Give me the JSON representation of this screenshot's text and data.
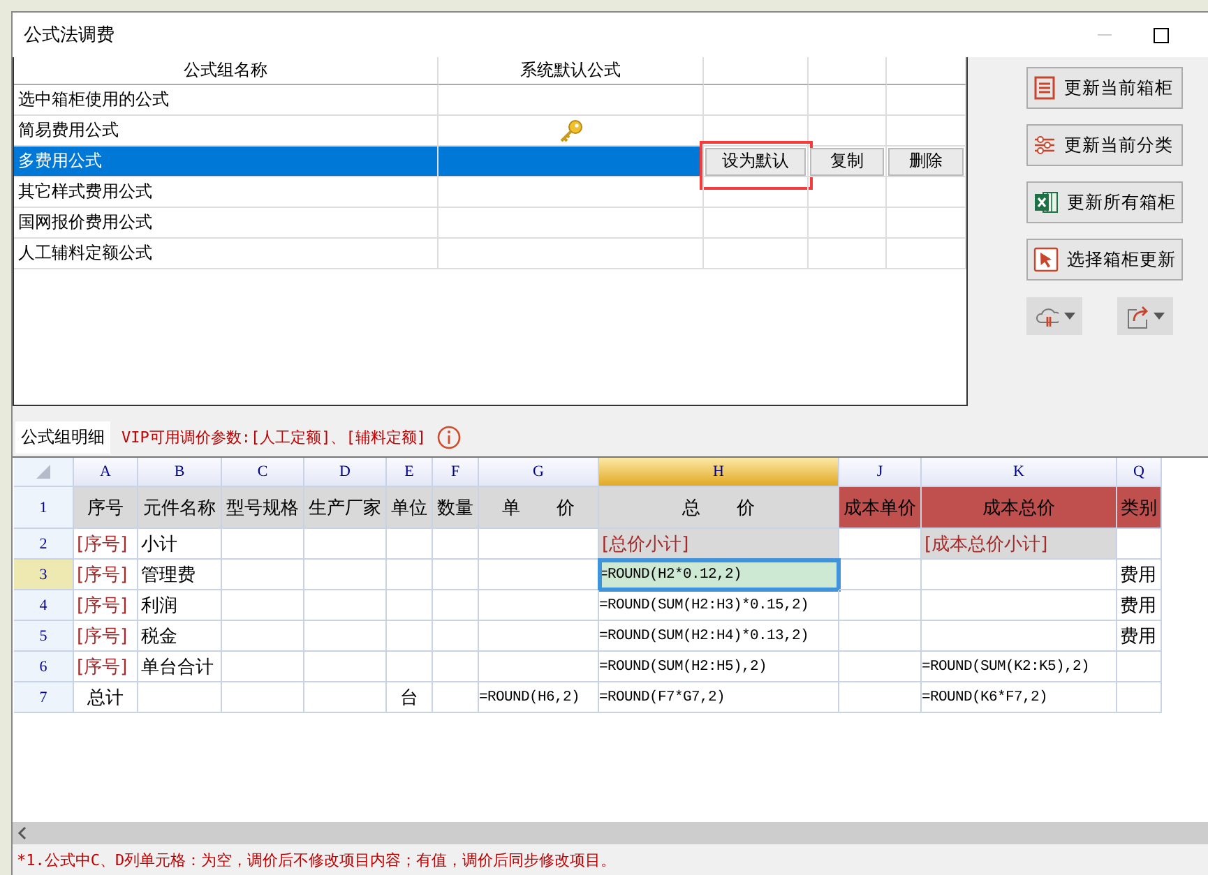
{
  "window": {
    "title": "公式法调费"
  },
  "formula_groups": {
    "columns": [
      "公式组名称",
      "系统默认公式"
    ],
    "rows": [
      {
        "name": "选中箱柜使用的公式",
        "is_default": false,
        "selected": false
      },
      {
        "name": "简易费用公式",
        "is_default": true,
        "selected": false
      },
      {
        "name": "多费用公式",
        "is_default": false,
        "selected": true
      },
      {
        "name": "其它样式费用公式",
        "is_default": false,
        "selected": false
      },
      {
        "name": "国网报价费用公式",
        "is_default": false,
        "selected": false
      },
      {
        "name": "人工辅料定额公式",
        "is_default": false,
        "selected": false
      }
    ],
    "row_actions": [
      {
        "label": "设为默认",
        "highlighted": true
      },
      {
        "label": "复制",
        "highlighted": false
      },
      {
        "label": "删除",
        "highlighted": false
      }
    ]
  },
  "side_buttons": [
    {
      "label": "更新当前箱柜"
    },
    {
      "label": "更新当前分类"
    },
    {
      "label": "更新所有箱柜"
    },
    {
      "label": "选择箱柜更新"
    }
  ],
  "detail": {
    "tab": "公式组明细",
    "vip_note": "VIP可用调价参数:[人工定额]、[辅料定额]",
    "columns": [
      {
        "letter": "A",
        "selected": false
      },
      {
        "letter": "B",
        "selected": false
      },
      {
        "letter": "C",
        "selected": false
      },
      {
        "letter": "D",
        "selected": false
      },
      {
        "letter": "E",
        "selected": false
      },
      {
        "letter": "F",
        "selected": false
      },
      {
        "letter": "G",
        "selected": false
      },
      {
        "letter": "H",
        "selected": true
      },
      {
        "letter": "J",
        "selected": false
      },
      {
        "letter": "K",
        "selected": false
      },
      {
        "letter": "Q",
        "selected": false
      }
    ],
    "rows": [
      {
        "number": "1",
        "selected": false,
        "cells": [
          {
            "text": "序号",
            "kind": "label"
          },
          {
            "text": "元件名称",
            "kind": "label"
          },
          {
            "text": "型号规格",
            "kind": "label"
          },
          {
            "text": "生产厂家",
            "kind": "label"
          },
          {
            "text": "单位",
            "kind": "label"
          },
          {
            "text": "数量",
            "kind": "label"
          },
          {
            "text": "单　　价",
            "kind": "label"
          },
          {
            "text": "总　　价",
            "kind": "label"
          },
          {
            "text": "成本单价",
            "kind": "cost_label"
          },
          {
            "text": "成本总价",
            "kind": "cost_label"
          },
          {
            "text": "类别",
            "kind": "cost_label"
          }
        ]
      },
      {
        "number": "2",
        "selected": false,
        "cells": [
          {
            "text": "[序号]",
            "kind": "token"
          },
          {
            "text": "小计",
            "kind": "text"
          },
          null,
          null,
          null,
          null,
          null,
          {
            "text": "[总价小计]",
            "kind": "subtotal"
          },
          null,
          {
            "text": "[成本总价小计]",
            "kind": "subtotal"
          },
          null
        ]
      },
      {
        "number": "3",
        "selected": true,
        "cells": [
          {
            "text": "[序号]",
            "kind": "token"
          },
          {
            "text": "管理费",
            "kind": "text"
          },
          null,
          null,
          null,
          null,
          null,
          {
            "text": "=ROUND(H2*0.12,2)",
            "kind": "formula",
            "selected": true
          },
          null,
          null,
          {
            "text": "费用",
            "kind": "text"
          }
        ]
      },
      {
        "number": "4",
        "selected": false,
        "cells": [
          {
            "text": "[序号]",
            "kind": "token"
          },
          {
            "text": "利润",
            "kind": "text"
          },
          null,
          null,
          null,
          null,
          null,
          {
            "text": "=ROUND(SUM(H2:H3)*0.15,2)",
            "kind": "formula"
          },
          null,
          null,
          {
            "text": "费用",
            "kind": "text"
          }
        ]
      },
      {
        "number": "5",
        "selected": false,
        "cells": [
          {
            "text": "[序号]",
            "kind": "token"
          },
          {
            "text": "税金",
            "kind": "text"
          },
          null,
          null,
          null,
          null,
          null,
          {
            "text": "=ROUND(SUM(H2:H4)*0.13,2)",
            "kind": "formula"
          },
          null,
          null,
          {
            "text": "费用",
            "kind": "text"
          }
        ]
      },
      {
        "number": "6",
        "selected": false,
        "cells": [
          {
            "text": "[序号]",
            "kind": "token"
          },
          {
            "text": "单台合计",
            "kind": "text"
          },
          null,
          null,
          null,
          null,
          null,
          {
            "text": "=ROUND(SUM(H2:H5),2)",
            "kind": "formula"
          },
          null,
          {
            "text": "=ROUND(SUM(K2:K5),2)",
            "kind": "formula"
          },
          null
        ]
      },
      {
        "number": "7",
        "selected": false,
        "cells": [
          {
            "text": "总计",
            "kind": "centered"
          },
          null,
          null,
          null,
          {
            "text": "台",
            "kind": "centered"
          },
          null,
          {
            "text": "=ROUND(H6,2)",
            "kind": "formula"
          },
          {
            "text": "=ROUND(F7*G7,2)",
            "kind": "formula"
          },
          null,
          {
            "text": "=ROUND(K6*F7,2)",
            "kind": "formula"
          },
          null
        ]
      }
    ]
  },
  "footer_note": "*1.公式中C、D列单元格：为空，调价后不修改项目内容；有值，调价后同步修改项目。"
}
